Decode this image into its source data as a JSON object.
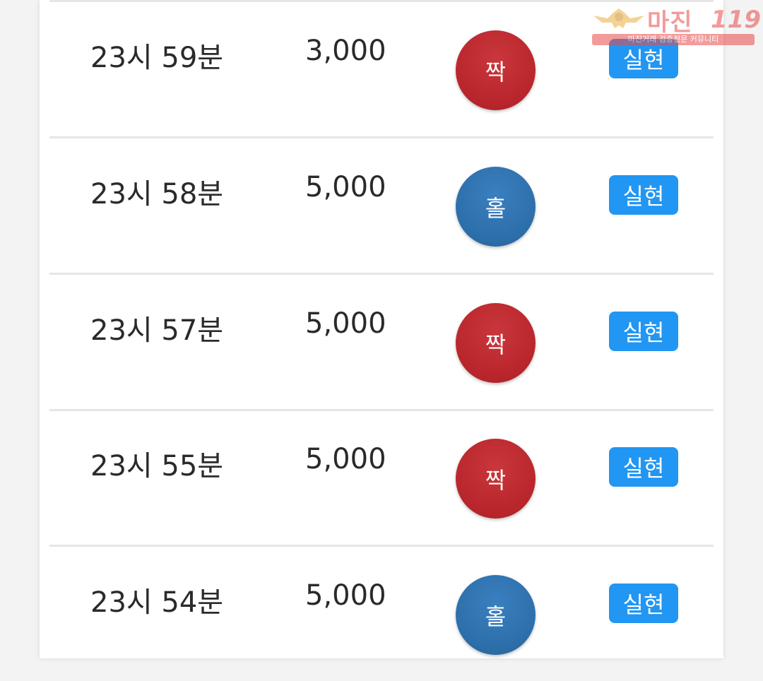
{
  "rows": [
    {
      "time": "23시 59분",
      "amount": "3,000",
      "result": "짝",
      "result_color": "red",
      "status": "실현"
    },
    {
      "time": "23시 58분",
      "amount": "5,000",
      "result": "홀",
      "result_color": "blue",
      "status": "실현"
    },
    {
      "time": "23시 57분",
      "amount": "5,000",
      "result": "짝",
      "result_color": "red",
      "status": "실현"
    },
    {
      "time": "23시 55분",
      "amount": "5,000",
      "result": "짝",
      "result_color": "red",
      "status": "실현"
    },
    {
      "time": "23시 54분",
      "amount": "5,000",
      "result": "홀",
      "result_color": "blue",
      "status": "실현"
    }
  ],
  "watermark": {
    "title": "마진",
    "number": "119",
    "subtitle": "마진거래 검증전문 커뮤니티",
    "emblem_icon": "eagle-emblem-icon"
  },
  "colors": {
    "even_red": "#b8262c",
    "odd_blue": "#2c6ea9",
    "badge_blue": "#2196f3",
    "watermark_red": "#e84a4a"
  }
}
